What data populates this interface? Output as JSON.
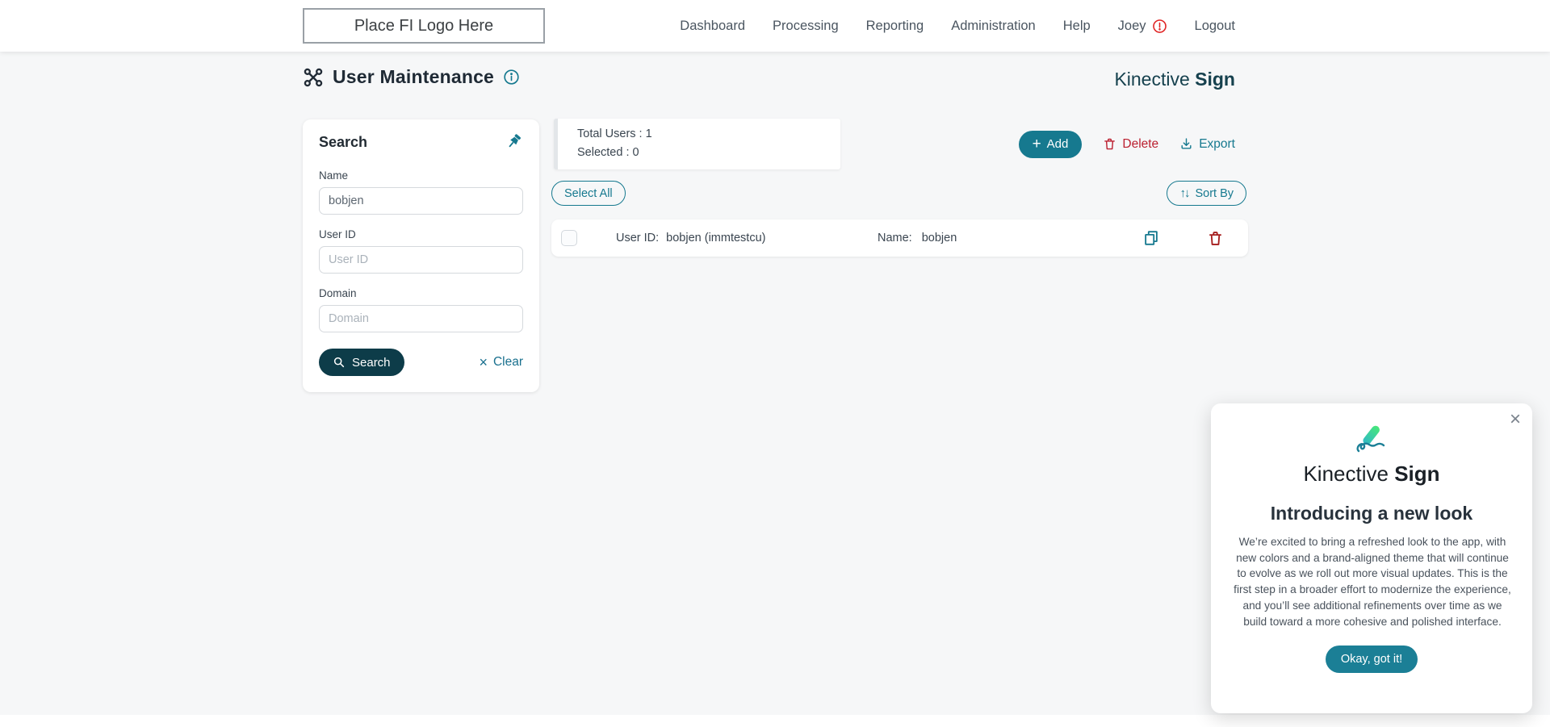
{
  "header": {
    "logo_placeholder": "Place FI Logo Here",
    "nav": [
      {
        "label": "Dashboard"
      },
      {
        "label": "Processing"
      },
      {
        "label": "Reporting"
      },
      {
        "label": "Administration"
      },
      {
        "label": "Help"
      },
      {
        "label": "Joey",
        "has_alert": true
      },
      {
        "label": "Logout"
      }
    ]
  },
  "page": {
    "title": "User Maintenance",
    "brand_name": "Kinective",
    "brand_product": "Sign"
  },
  "search_panel": {
    "title": "Search",
    "name_label": "Name",
    "name_value": "bobjen",
    "user_id_label": "User ID",
    "user_id_placeholder": "User ID",
    "domain_label": "Domain",
    "domain_placeholder": "Domain",
    "search_button": "Search",
    "clear_button": "Clear"
  },
  "toolbar": {
    "total_users_line": "Total Users : 1",
    "selected_line": "Selected : 0",
    "add_button": "Add",
    "delete_button": "Delete",
    "export_button": "Export",
    "select_all_button": "Select All",
    "sort_by_button": "Sort By"
  },
  "user_list": {
    "rows": [
      {
        "user_id_label": "User ID:",
        "user_id": "bobjen (immtestcu)",
        "name_label": "Name:",
        "name": "bobjen"
      }
    ]
  },
  "popup": {
    "brand_name": "Kinective",
    "brand_product": "Sign",
    "heading": "Introducing a new look",
    "body": "We’re excited to bring a refreshed look to the app, with new colors and a brand-aligned theme that will continue to evolve as we roll out more visual updates. This is the first step in a broader effort to modernize the experience, and you’ll see additional refinements over time as we build toward a more cohesive and polished interface.",
    "button": "Okay, got it!"
  },
  "icons": {
    "close": "×",
    "plus": "+",
    "clear_x": "×",
    "sort_arrows": "↑↓"
  },
  "colors": {
    "teal": "#16798F",
    "dark_teal": "#0D3C49",
    "brand_dark": "#16414E",
    "red": "#BB1F2F",
    "background": "#F6F7F8"
  }
}
